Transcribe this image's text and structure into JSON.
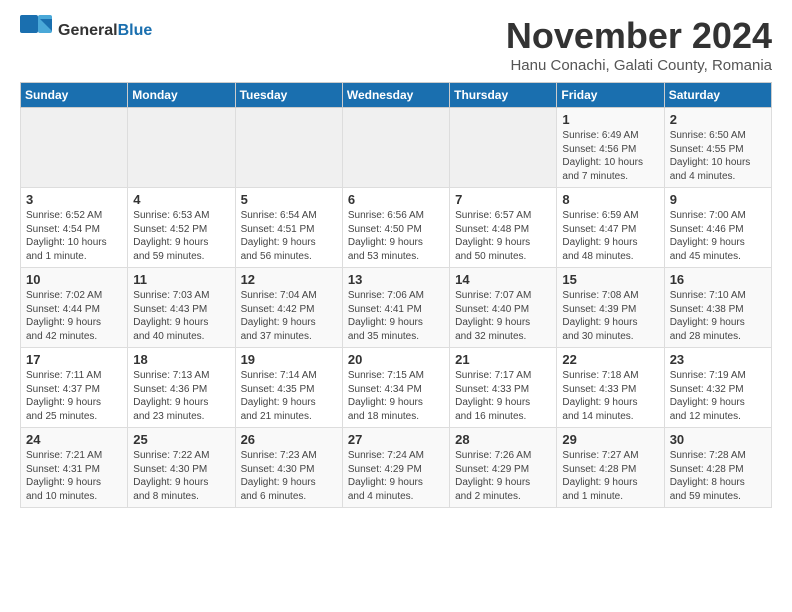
{
  "logo": {
    "general": "General",
    "blue": "Blue",
    "tagline": ""
  },
  "header": {
    "month": "November 2024",
    "location": "Hanu Conachi, Galati County, Romania"
  },
  "weekdays": [
    "Sunday",
    "Monday",
    "Tuesday",
    "Wednesday",
    "Thursday",
    "Friday",
    "Saturday"
  ],
  "weeks": [
    [
      {
        "day": "",
        "info": ""
      },
      {
        "day": "",
        "info": ""
      },
      {
        "day": "",
        "info": ""
      },
      {
        "day": "",
        "info": ""
      },
      {
        "day": "",
        "info": ""
      },
      {
        "day": "1",
        "info": "Sunrise: 6:49 AM\nSunset: 4:56 PM\nDaylight: 10 hours\nand 7 minutes."
      },
      {
        "day": "2",
        "info": "Sunrise: 6:50 AM\nSunset: 4:55 PM\nDaylight: 10 hours\nand 4 minutes."
      }
    ],
    [
      {
        "day": "3",
        "info": "Sunrise: 6:52 AM\nSunset: 4:54 PM\nDaylight: 10 hours\nand 1 minute."
      },
      {
        "day": "4",
        "info": "Sunrise: 6:53 AM\nSunset: 4:52 PM\nDaylight: 9 hours\nand 59 minutes."
      },
      {
        "day": "5",
        "info": "Sunrise: 6:54 AM\nSunset: 4:51 PM\nDaylight: 9 hours\nand 56 minutes."
      },
      {
        "day": "6",
        "info": "Sunrise: 6:56 AM\nSunset: 4:50 PM\nDaylight: 9 hours\nand 53 minutes."
      },
      {
        "day": "7",
        "info": "Sunrise: 6:57 AM\nSunset: 4:48 PM\nDaylight: 9 hours\nand 50 minutes."
      },
      {
        "day": "8",
        "info": "Sunrise: 6:59 AM\nSunset: 4:47 PM\nDaylight: 9 hours\nand 48 minutes."
      },
      {
        "day": "9",
        "info": "Sunrise: 7:00 AM\nSunset: 4:46 PM\nDaylight: 9 hours\nand 45 minutes."
      }
    ],
    [
      {
        "day": "10",
        "info": "Sunrise: 7:02 AM\nSunset: 4:44 PM\nDaylight: 9 hours\nand 42 minutes."
      },
      {
        "day": "11",
        "info": "Sunrise: 7:03 AM\nSunset: 4:43 PM\nDaylight: 9 hours\nand 40 minutes."
      },
      {
        "day": "12",
        "info": "Sunrise: 7:04 AM\nSunset: 4:42 PM\nDaylight: 9 hours\nand 37 minutes."
      },
      {
        "day": "13",
        "info": "Sunrise: 7:06 AM\nSunset: 4:41 PM\nDaylight: 9 hours\nand 35 minutes."
      },
      {
        "day": "14",
        "info": "Sunrise: 7:07 AM\nSunset: 4:40 PM\nDaylight: 9 hours\nand 32 minutes."
      },
      {
        "day": "15",
        "info": "Sunrise: 7:08 AM\nSunset: 4:39 PM\nDaylight: 9 hours\nand 30 minutes."
      },
      {
        "day": "16",
        "info": "Sunrise: 7:10 AM\nSunset: 4:38 PM\nDaylight: 9 hours\nand 28 minutes."
      }
    ],
    [
      {
        "day": "17",
        "info": "Sunrise: 7:11 AM\nSunset: 4:37 PM\nDaylight: 9 hours\nand 25 minutes."
      },
      {
        "day": "18",
        "info": "Sunrise: 7:13 AM\nSunset: 4:36 PM\nDaylight: 9 hours\nand 23 minutes."
      },
      {
        "day": "19",
        "info": "Sunrise: 7:14 AM\nSunset: 4:35 PM\nDaylight: 9 hours\nand 21 minutes."
      },
      {
        "day": "20",
        "info": "Sunrise: 7:15 AM\nSunset: 4:34 PM\nDaylight: 9 hours\nand 18 minutes."
      },
      {
        "day": "21",
        "info": "Sunrise: 7:17 AM\nSunset: 4:33 PM\nDaylight: 9 hours\nand 16 minutes."
      },
      {
        "day": "22",
        "info": "Sunrise: 7:18 AM\nSunset: 4:33 PM\nDaylight: 9 hours\nand 14 minutes."
      },
      {
        "day": "23",
        "info": "Sunrise: 7:19 AM\nSunset: 4:32 PM\nDaylight: 9 hours\nand 12 minutes."
      }
    ],
    [
      {
        "day": "24",
        "info": "Sunrise: 7:21 AM\nSunset: 4:31 PM\nDaylight: 9 hours\nand 10 minutes."
      },
      {
        "day": "25",
        "info": "Sunrise: 7:22 AM\nSunset: 4:30 PM\nDaylight: 9 hours\nand 8 minutes."
      },
      {
        "day": "26",
        "info": "Sunrise: 7:23 AM\nSunset: 4:30 PM\nDaylight: 9 hours\nand 6 minutes."
      },
      {
        "day": "27",
        "info": "Sunrise: 7:24 AM\nSunset: 4:29 PM\nDaylight: 9 hours\nand 4 minutes."
      },
      {
        "day": "28",
        "info": "Sunrise: 7:26 AM\nSunset: 4:29 PM\nDaylight: 9 hours\nand 2 minutes."
      },
      {
        "day": "29",
        "info": "Sunrise: 7:27 AM\nSunset: 4:28 PM\nDaylight: 9 hours\nand 1 minute."
      },
      {
        "day": "30",
        "info": "Sunrise: 7:28 AM\nSunset: 4:28 PM\nDaylight: 8 hours\nand 59 minutes."
      }
    ]
  ]
}
